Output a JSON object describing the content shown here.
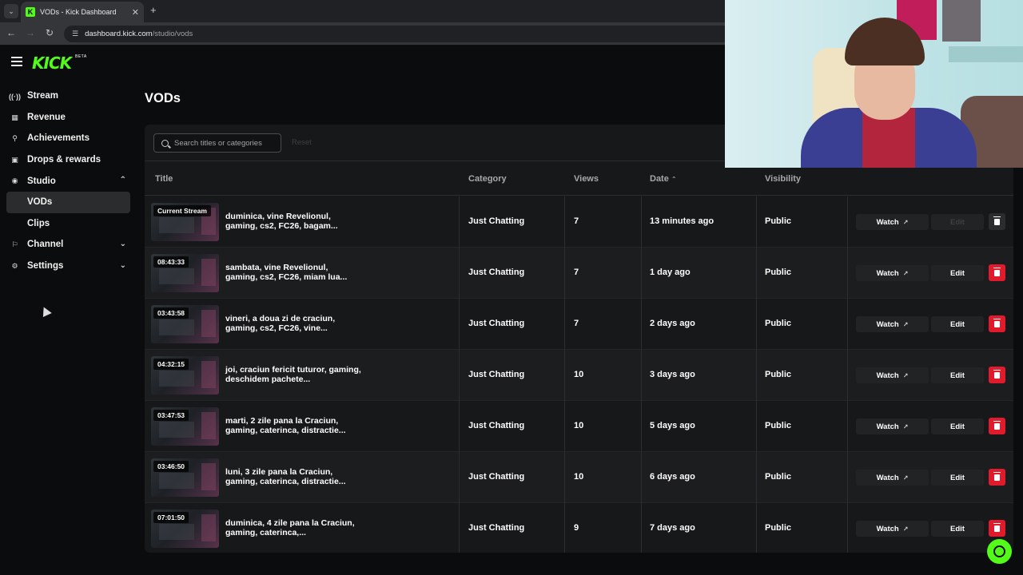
{
  "browser": {
    "tab_title": "VODs - Kick Dashboard",
    "url_host": "dashboard.kick.com",
    "url_path": "/studio/vods"
  },
  "app": {
    "logo": "KICK",
    "beta": "BETA",
    "page_title": "VODs"
  },
  "sidebar": {
    "items": [
      {
        "label": "Stream",
        "icon": "broadcast-icon"
      },
      {
        "label": "Revenue",
        "icon": "chart-icon"
      },
      {
        "label": "Achievements",
        "icon": "trophy-icon"
      },
      {
        "label": "Drops & rewards",
        "icon": "gift-icon"
      },
      {
        "label": "Studio",
        "icon": "studio-icon",
        "expanded": true
      },
      {
        "label": "Channel",
        "icon": "channel-icon",
        "expanded": false
      },
      {
        "label": "Settings",
        "icon": "gear-icon",
        "expanded": false
      }
    ],
    "studio_sub": [
      {
        "label": "VODs",
        "active": true
      },
      {
        "label": "Clips",
        "active": false
      }
    ]
  },
  "toolbar": {
    "search_placeholder": "Search titles or categories",
    "reset_label": "Reset"
  },
  "table": {
    "headers": {
      "title": "Title",
      "category": "Category",
      "views": "Views",
      "date": "Date",
      "visibility": "Visibility"
    },
    "sort": "date-ascending",
    "watch_label": "Watch",
    "edit_label": "Edit",
    "rows": [
      {
        "duration": "Current Stream",
        "title": "duminica, vine Revelionul, gaming, cs2, FC26, bagam...",
        "category": "Just Chatting",
        "views": "7",
        "date": "13 minutes ago",
        "visibility": "Public",
        "editable": false
      },
      {
        "duration": "08:43:33",
        "title": "sambata, vine Revelionul, gaming, cs2, FC26, miam lua...",
        "category": "Just Chatting",
        "views": "7",
        "date": "1 day ago",
        "visibility": "Public",
        "editable": true
      },
      {
        "duration": "03:43:58",
        "title": "vineri, a doua zi de craciun, gaming, cs2, FC26, vine...",
        "category": "Just Chatting",
        "views": "7",
        "date": "2 days ago",
        "visibility": "Public",
        "editable": true
      },
      {
        "duration": "04:32:15",
        "title": "joi, craciun fericit tuturor, gaming, deschidem pachete...",
        "category": "Just Chatting",
        "views": "10",
        "date": "3 days ago",
        "visibility": "Public",
        "editable": true
      },
      {
        "duration": "03:47:53",
        "title": "marti, 2 zile pana la Craciun, gaming, caterinca, distractie...",
        "category": "Just Chatting",
        "views": "10",
        "date": "5 days ago",
        "visibility": "Public",
        "editable": true
      },
      {
        "duration": "03:46:50",
        "title": "luni, 3 zile pana la Craciun, gaming, caterinca, distractie...",
        "category": "Just Chatting",
        "views": "10",
        "date": "6 days ago",
        "visibility": "Public",
        "editable": true
      },
      {
        "duration": "07:01:50",
        "title": "duminica, 4 zile pana la Craciun, gaming, caterinca,...",
        "category": "Just Chatting",
        "views": "9",
        "date": "7 days ago",
        "visibility": "Public",
        "editable": true
      }
    ]
  },
  "colors": {
    "accent": "#53fc18",
    "danger": "#e21b2c",
    "background": "#0b0c0d",
    "panel": "#17181a"
  }
}
